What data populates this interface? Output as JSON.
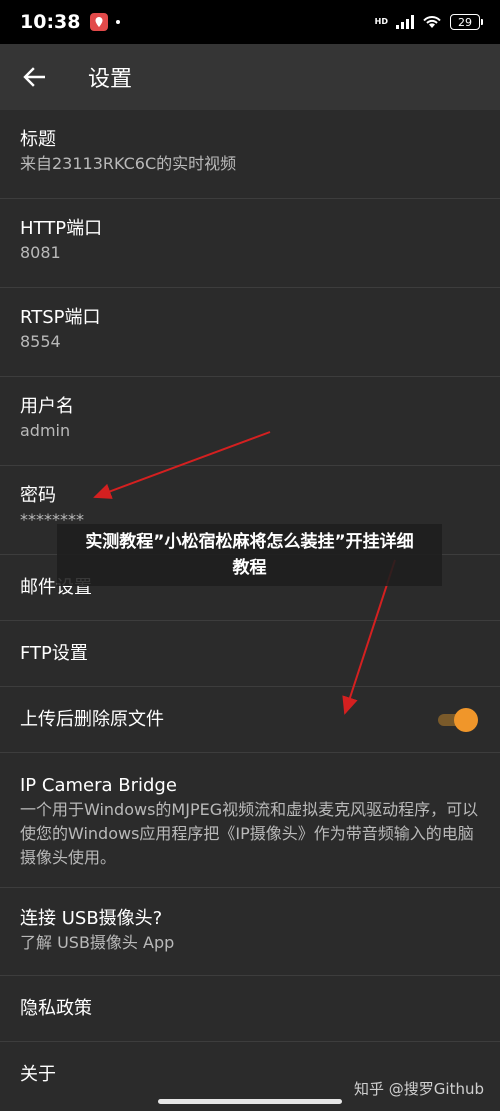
{
  "status": {
    "time": "10:38",
    "network": "HD",
    "battery": "29"
  },
  "header": {
    "back_icon": "arrow-left-icon",
    "title": "设置"
  },
  "settings": {
    "title": {
      "label": "标题",
      "value": "来自23113RKC6C的实时视频"
    },
    "http_port": {
      "label": "HTTP端口",
      "value": "8081"
    },
    "rtsp_port": {
      "label": "RTSP端口",
      "value": "8554"
    },
    "username": {
      "label": "用户名",
      "value": "admin"
    },
    "password": {
      "label": "密码",
      "value": "********"
    },
    "mail": {
      "label": "邮件设置"
    },
    "ftp": {
      "label": "FTP设置"
    },
    "delete_after_upload": {
      "label": "上传后删除原文件",
      "enabled": true
    },
    "ip_camera_bridge": {
      "label": "IP Camera Bridge",
      "description": "一个用于Windows的MJPEG视频流和虚拟麦克风驱动程序，可以使您的Windows应用程序把《IP摄像头》作为带音频输入的电脑摄像头使用。"
    },
    "usb_camera": {
      "label": "连接 USB摄像头?",
      "value": "了解 USB摄像头 App"
    },
    "privacy": {
      "label": "隐私政策"
    },
    "about": {
      "label": "关于"
    }
  },
  "overlay": {
    "text": "实测教程”小松宿松麻将怎么装挂”开挂详细教程"
  },
  "watermark": "知乎 @搜罗Github",
  "colors": {
    "background": "#2b2b2b",
    "app_bar": "#353535",
    "accent": "#f0962a",
    "annotation_arrow": "#d42020"
  }
}
